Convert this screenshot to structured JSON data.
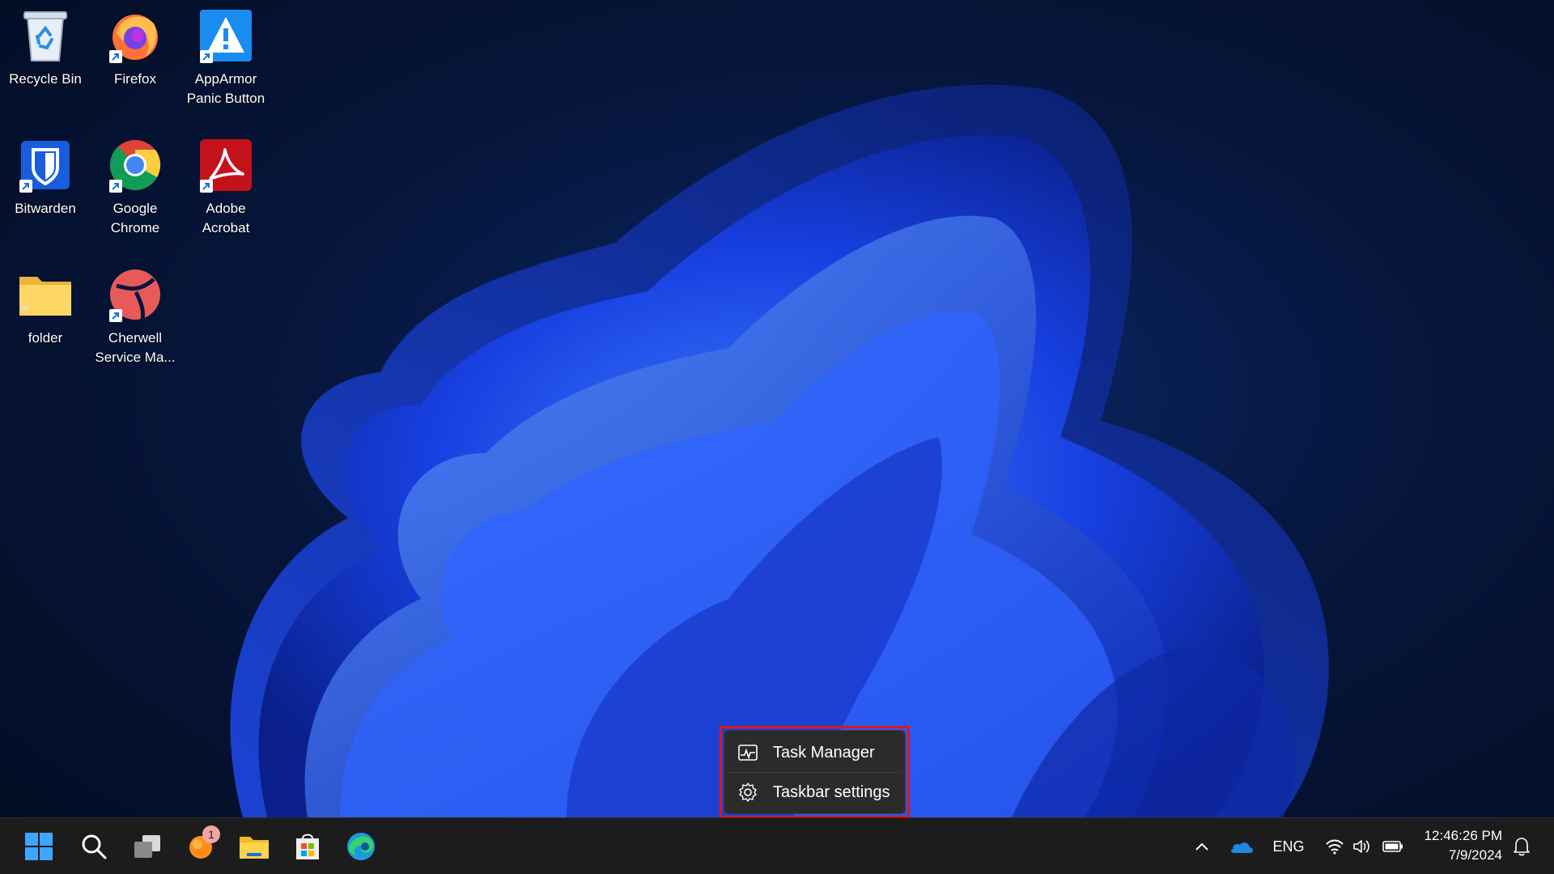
{
  "desktop_icons": [
    {
      "label": "Recycle Bin",
      "icon": "recycle-bin-icon",
      "shortcut": false
    },
    {
      "label": "Firefox",
      "icon": "firefox-icon",
      "shortcut": true
    },
    {
      "label": "AppArmor\nPanic Button",
      "icon": "apparmor-icon",
      "shortcut": true
    },
    {
      "label": "Bitwarden",
      "icon": "bitwarden-icon",
      "shortcut": true
    },
    {
      "label": "Google\nChrome",
      "icon": "chrome-icon",
      "shortcut": true
    },
    {
      "label": "Adobe\nAcrobat",
      "icon": "acrobat-icon",
      "shortcut": true
    },
    {
      "label": "folder",
      "icon": "folder-icon",
      "shortcut": false
    },
    {
      "label": "Cherwell\nService Ma...",
      "icon": "cherwell-icon",
      "shortcut": true
    }
  ],
  "context_menu": {
    "items": [
      {
        "label": "Task Manager",
        "icon": "task-manager-icon"
      },
      {
        "label": "Taskbar settings",
        "icon": "gear-icon"
      }
    ],
    "highlight_color": "#e0141e"
  },
  "taskbar": {
    "pinned": [
      {
        "name": "start",
        "icon": "windows-start-icon"
      },
      {
        "name": "search",
        "icon": "search-icon"
      },
      {
        "name": "task-view",
        "icon": "task-view-icon"
      },
      {
        "name": "app",
        "icon": "orange-app-icon",
        "badge": "1"
      },
      {
        "name": "file-explorer",
        "icon": "file-explorer-icon"
      },
      {
        "name": "store",
        "icon": "microsoft-store-icon"
      },
      {
        "name": "edge",
        "icon": "edge-icon"
      }
    ],
    "tray": {
      "language": "ENG",
      "time": "12:46:26 PM",
      "date": "7/9/2024"
    }
  },
  "colors": {
    "taskbar_bg": "#1c1c1c",
    "menu_bg": "#2b2b2b",
    "accent_blue": "#1e5bff"
  }
}
